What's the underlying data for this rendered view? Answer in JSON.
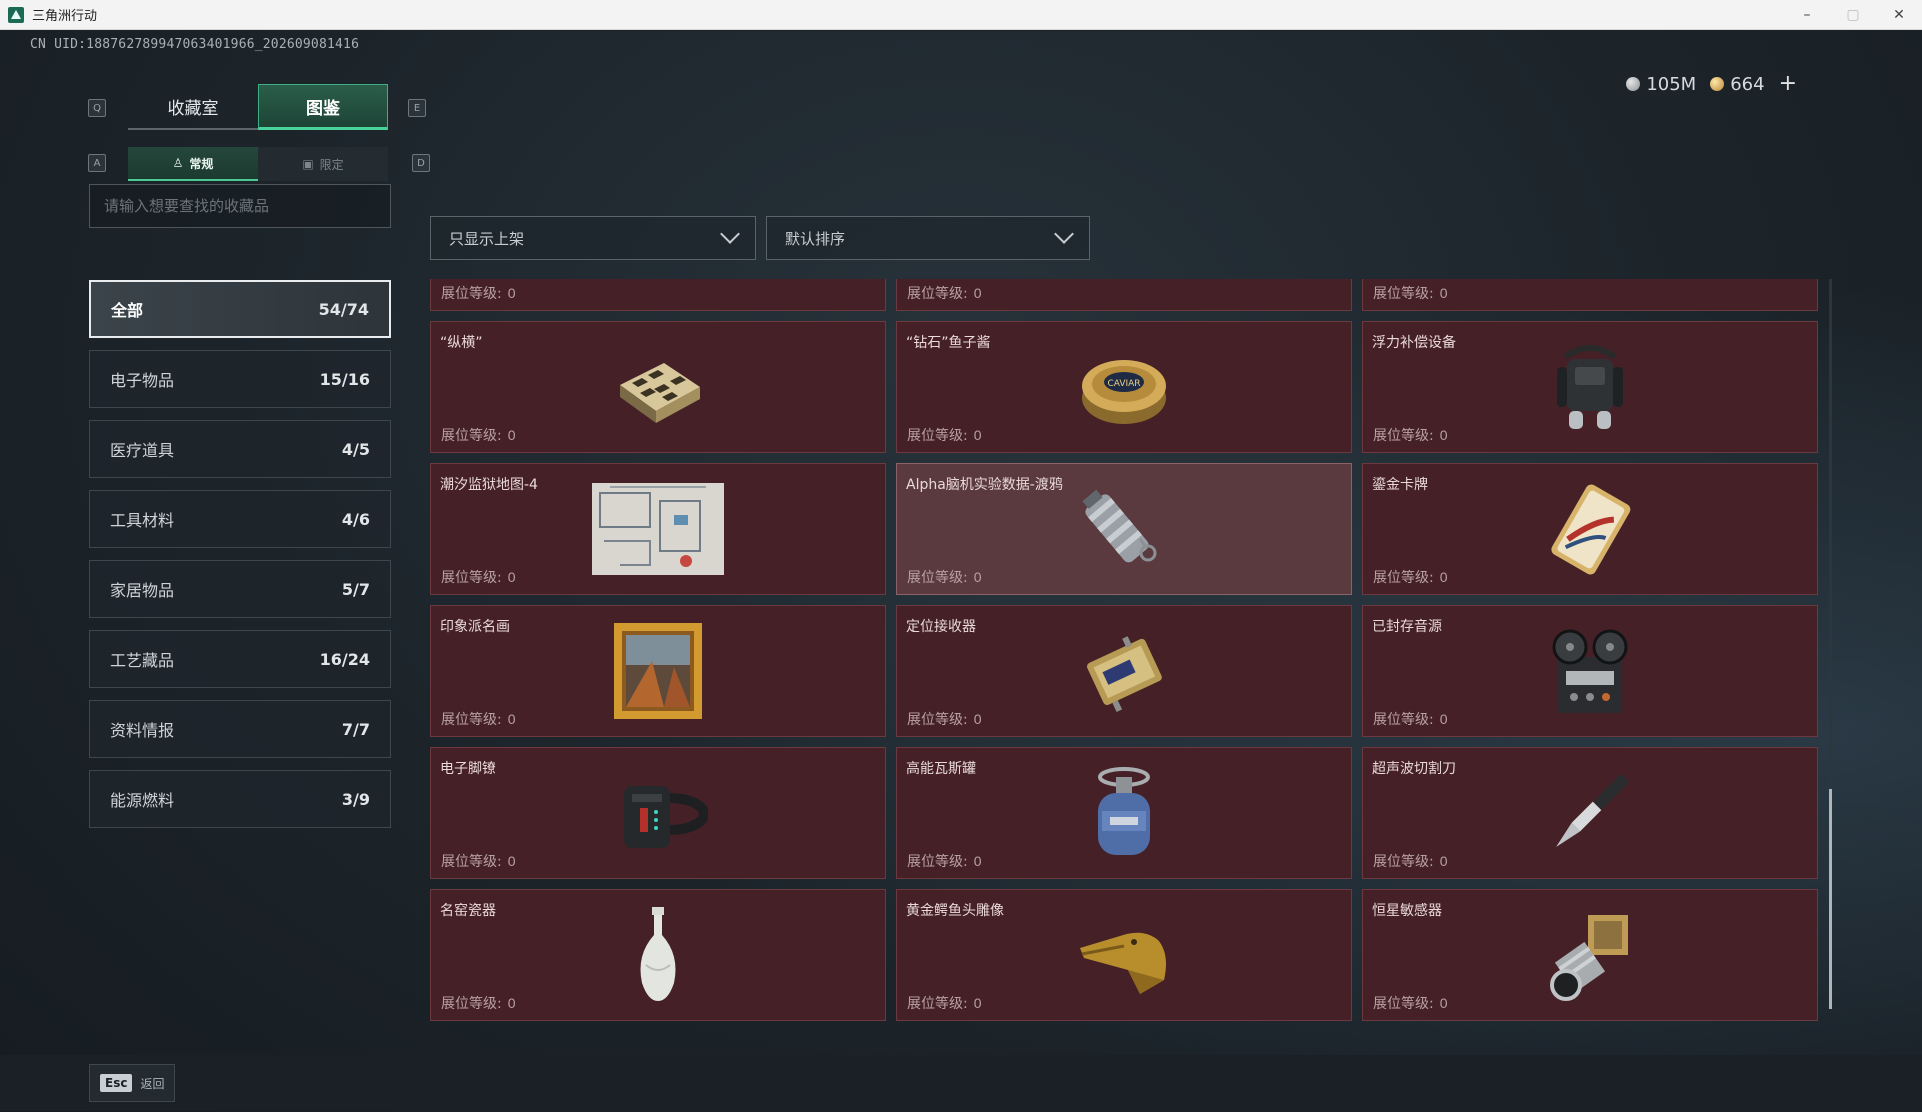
{
  "window": {
    "title": "三角洲行动",
    "controls": [
      "–",
      "▢",
      "✕"
    ]
  },
  "uid": "CN UID:18876278994706340196​6_202609081416",
  "currency": {
    "silver": "105M",
    "gold": "664",
    "add": "+"
  },
  "keys": {
    "q": "Q",
    "e": "E",
    "a": "A",
    "d": "D"
  },
  "main_tabs": [
    {
      "label": "收藏室",
      "active": false
    },
    {
      "label": "图鉴",
      "active": true
    }
  ],
  "sub_tabs": [
    {
      "label": "常规",
      "active": true,
      "icon": "pin-icon"
    },
    {
      "label": "限定",
      "active": false,
      "icon": "picture-icon"
    }
  ],
  "search": {
    "placeholder": "请输入想要查找的收藏品"
  },
  "categories": [
    {
      "label": "全部",
      "count": "54/74",
      "active": true
    },
    {
      "label": "电子物品",
      "count": "15/16"
    },
    {
      "label": "医疗道具",
      "count": "4/5"
    },
    {
      "label": "工具材料",
      "count": "4/6"
    },
    {
      "label": "家居物品",
      "count": "5/7"
    },
    {
      "label": "工艺藏品",
      "count": "16/24"
    },
    {
      "label": "资料情报",
      "count": "7/7"
    },
    {
      "label": "能源燃料",
      "count": "3/9"
    }
  ],
  "filters": {
    "shelf": "只显示上架",
    "sort": "默认排序"
  },
  "level_label": "展位等级:",
  "items": [
    {
      "name": "",
      "level": "0",
      "icon": "partial-item-icon"
    },
    {
      "name": "",
      "level": "0",
      "icon": "partial-item-icon"
    },
    {
      "name": "",
      "level": "0",
      "icon": "partial-item-icon"
    },
    {
      "name": "“纵横”",
      "level": "0",
      "icon": "chess-box-icon"
    },
    {
      "name": "“钻石”鱼子酱",
      "level": "0",
      "icon": "caviar-tin-icon"
    },
    {
      "name": "浮力补偿设备",
      "level": "0",
      "icon": "buoyancy-device-icon"
    },
    {
      "name": "潮汐监狱地图-4",
      "level": "0",
      "icon": "map-icon"
    },
    {
      "name": "Alpha脑机实验数据-渡鸦",
      "level": "0",
      "icon": "data-canister-icon",
      "highlight": true
    },
    {
      "name": "鎏金卡牌",
      "level": "0",
      "icon": "gold-card-icon"
    },
    {
      "name": "印象派名画",
      "level": "0",
      "icon": "painting-icon"
    },
    {
      "name": "定位接收器",
      "level": "0",
      "icon": "receiver-icon"
    },
    {
      "name": "已封存音源",
      "level": "0",
      "icon": "reel-recorder-icon"
    },
    {
      "name": "电子脚镣",
      "level": "0",
      "icon": "ankle-monitor-icon"
    },
    {
      "name": "高能瓦斯罐",
      "level": "0",
      "icon": "gas-canister-icon"
    },
    {
      "name": "超声波切割刀",
      "level": "0",
      "icon": "scalpel-icon"
    },
    {
      "name": "名窑瓷器",
      "level": "0",
      "icon": "porcelain-vase-icon"
    },
    {
      "name": "黄金鳄鱼头雕像",
      "level": "0",
      "icon": "gold-crocodile-icon"
    },
    {
      "name": "恒星敏感器",
      "level": "0",
      "icon": "star-sensor-icon"
    }
  ],
  "bottom": {
    "esc_key": "Esc",
    "back_label": "返回"
  }
}
